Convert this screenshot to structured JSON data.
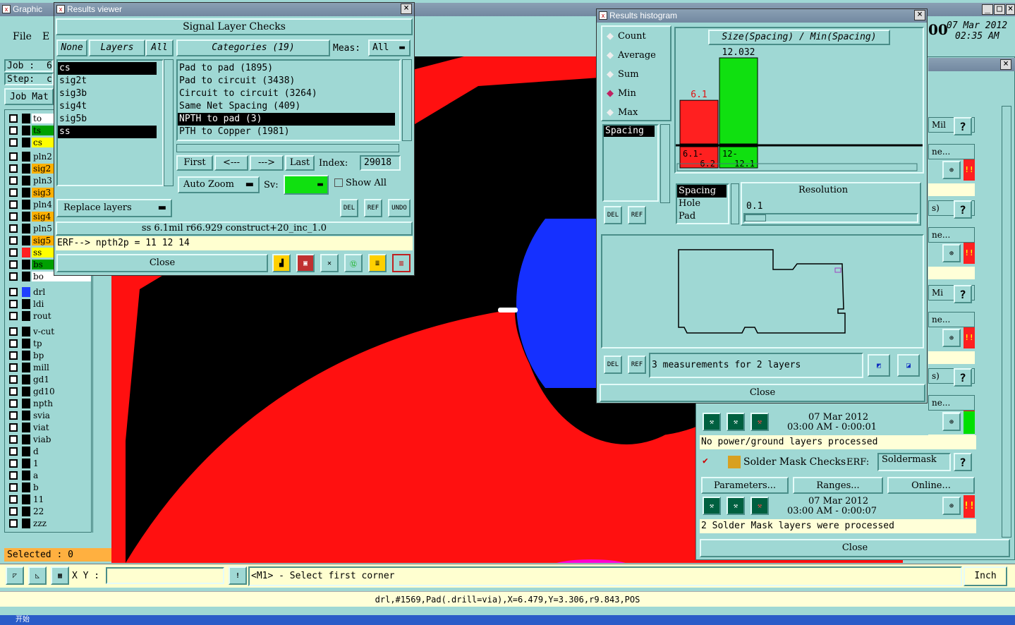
{
  "main_window": {
    "title": "Graphic",
    "menu": [
      "File",
      "E"
    ],
    "job_label": "Job :",
    "job_value": "6",
    "step_label": "Step:",
    "step_value": "c",
    "job_matrix": "Job Mat",
    "selected": "Selected : 0",
    "xy_label": "X Y :",
    "xy_value": "",
    "prompt": "<M1> - Select first corner",
    "unit": "Inch",
    "status_line": "drl,#1569,Pad(.drill=via),X=6.479,Y=3.306,r9.843,POS",
    "date": "07 Mar 2012",
    "time": "02:35 AM",
    "date_prefix": "00"
  },
  "layers": [
    {
      "name": "to",
      "color": "#ffffff",
      "swatch": "#000000"
    },
    {
      "name": "ts",
      "color": "#00a000",
      "swatch": "#000000"
    },
    {
      "name": "cs",
      "color": "#ffff00",
      "swatch": "#000000"
    },
    {
      "name": "pln2",
      "color": "#9fd8d4",
      "swatch": "#000000"
    },
    {
      "name": "sig2",
      "color": "#ffb000",
      "swatch": "#000000"
    },
    {
      "name": "pln3",
      "color": "#9fd8d4",
      "swatch": "#000000"
    },
    {
      "name": "sig3",
      "color": "#ffb000",
      "swatch": "#000000"
    },
    {
      "name": "pln4",
      "color": "#9fd8d4",
      "swatch": "#000000"
    },
    {
      "name": "sig4",
      "color": "#ffb000",
      "swatch": "#000000"
    },
    {
      "name": "pln5",
      "color": "#9fd8d4",
      "swatch": "#000000"
    },
    {
      "name": "sig5",
      "color": "#ffb000",
      "swatch": "#000000"
    },
    {
      "name": "ss",
      "color": "#ffff00",
      "swatch": "#ff2020"
    },
    {
      "name": "bs",
      "color": "#00a000",
      "swatch": "#000000"
    },
    {
      "name": "bo",
      "color": "#ffffff",
      "swatch": "#000000"
    },
    {
      "name": "drl",
      "color": "#9fd8d4",
      "swatch": "#2040ff"
    },
    {
      "name": "ldi",
      "color": "#9fd8d4",
      "swatch": "#000000"
    },
    {
      "name": "rout",
      "color": "#9fd8d4",
      "swatch": "#000000"
    },
    {
      "name": "v-cut",
      "color": "#9fd8d4",
      "swatch": "#000000"
    },
    {
      "name": "tp",
      "color": "#9fd8d4",
      "swatch": "#000000"
    },
    {
      "name": "bp",
      "color": "#9fd8d4",
      "swatch": "#000000"
    },
    {
      "name": "mill",
      "color": "#9fd8d4",
      "swatch": "#000000"
    },
    {
      "name": "gd1",
      "color": "#9fd8d4",
      "swatch": "#000000"
    },
    {
      "name": "gd10",
      "color": "#9fd8d4",
      "swatch": "#000000"
    },
    {
      "name": "npth",
      "color": "#9fd8d4",
      "swatch": "#000000"
    },
    {
      "name": "svia",
      "color": "#9fd8d4",
      "swatch": "#000000"
    },
    {
      "name": "viat",
      "color": "#9fd8d4",
      "swatch": "#000000"
    },
    {
      "name": "viab",
      "color": "#9fd8d4",
      "swatch": "#000000"
    },
    {
      "name": "d",
      "color": "#9fd8d4",
      "swatch": "#000000"
    },
    {
      "name": "1",
      "color": "#9fd8d4",
      "swatch": "#000000"
    },
    {
      "name": "a",
      "color": "#9fd8d4",
      "swatch": "#000000"
    },
    {
      "name": "b",
      "color": "#9fd8d4",
      "swatch": "#000000"
    },
    {
      "name": "11",
      "color": "#9fd8d4",
      "swatch": "#000000"
    },
    {
      "name": "22",
      "color": "#9fd8d4",
      "swatch": "#000000"
    },
    {
      "name": "zzz",
      "color": "#9fd8d4",
      "swatch": "#000000"
    }
  ],
  "results_viewer": {
    "title": "Results viewer",
    "header": "Signal Layer Checks",
    "none_btn": "None",
    "layers_label": "Layers",
    "all_btn": "All",
    "layer_list": [
      "cs",
      "sig2t",
      "sig3b",
      "sig4t",
      "sig5b",
      "ss"
    ],
    "categories_label": "Categories (19)",
    "meas_label": "Meas:",
    "meas_value": "All",
    "categories": [
      "Pad to pad (1895)",
      "Pad to circuit (3438)",
      "Circuit to circuit (3264)",
      "Same Net Spacing (409)",
      "NPTH to pad (3)",
      "PTH to Copper (1981)"
    ],
    "first": "First",
    "prev": "<---",
    "next": "--->",
    "last": "Last",
    "index_label": "Index:",
    "index_value": "29018",
    "replace_layers": "Replace layers",
    "auto_zoom": "Auto Zoom",
    "sv_label": "Sv:",
    "show_all": "Show All",
    "del": "DEL",
    "ref": "REF",
    "undo": "UNDO",
    "info_line": "ss 6.1mil r66.929 construct+20_inc_1.0",
    "erf_line": "ERF--> npth2p = 11 12 14",
    "close": "Close"
  },
  "histogram": {
    "title": "Results histogram",
    "modes": [
      "Count",
      "Average",
      "Sum",
      "Min",
      "Max"
    ],
    "selected_mode": "Min",
    "chart_title": "Size(Spacing) / Min(Spacing)",
    "measure_list": [
      "Spacing"
    ],
    "type_list": [
      "Spacing",
      "Hole",
      "Pad"
    ],
    "resolution_label": "Resolution",
    "resolution_value": "0.1",
    "summary": "3 measurements for 2 layers",
    "del": "DEL",
    "ref": "REF",
    "close": "Close"
  },
  "chart_data": {
    "type": "bar",
    "title": "Size(Spacing) / Min(Spacing)",
    "categories": [
      "6.1-6.2",
      "12-12.1"
    ],
    "values": [
      6.1,
      12.032
    ],
    "value_labels": [
      "6.1",
      "12.032"
    ],
    "colors": [
      "#ff2020",
      "#10e010"
    ],
    "ylim": [
      0,
      12.032
    ]
  },
  "checklist": {
    "date1": "07 Mar 2012",
    "time1": "03:00 AM - 0:00:01",
    "status1": "No power/ground layers processed",
    "solder_label": "Solder Mask Checks",
    "erf_label": "ERF:",
    "erf_value": "Soldermask",
    "parameters": "Parameters...",
    "ranges": "Ranges...",
    "online": "Online...",
    "date2": "07 Mar 2012",
    "time2": "03:00 AM - 0:00:07",
    "status2": "2 Solder Mask layers were processed",
    "close": "Close",
    "side_labels": [
      "Mil",
      "ne...",
      "s)",
      "ne...",
      "Mi",
      "ne...",
      "s)",
      "ne..."
    ]
  },
  "taskbar_start": "开始"
}
